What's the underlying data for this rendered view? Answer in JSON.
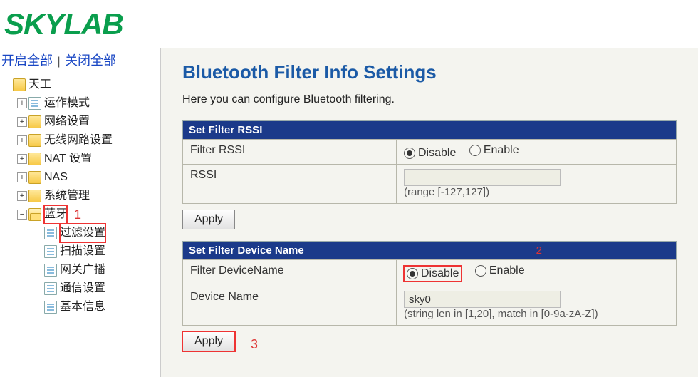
{
  "logo": "SKYLAB",
  "top_links": {
    "open_all": "开启全部",
    "close_all": "关闭全部"
  },
  "tree": {
    "root": "天工",
    "items": [
      "运作模式",
      "网络设置",
      "无线网路设置",
      "NAT 设置",
      "NAS",
      "系统管理"
    ],
    "bluetooth": "蓝牙",
    "bt_children": [
      "过滤设置",
      "扫描设置",
      "网关广播",
      "通信设置",
      "基本信息"
    ]
  },
  "page": {
    "title": "Bluetooth Filter Info Settings",
    "subtitle": "Here you can configure Bluetooth filtering."
  },
  "rssi": {
    "header": "Set Filter RSSI",
    "row1_label": "Filter RSSI",
    "row2_label": "RSSI",
    "disable": "Disable",
    "enable": "Enable",
    "value": "",
    "hint": "(range [-127,127])",
    "apply": "Apply"
  },
  "devname": {
    "header": "Set Filter Device Name",
    "row1_label": "Filter DeviceName",
    "row2_label": "Device Name",
    "disable": "Disable",
    "enable": "Enable",
    "value": "sky0",
    "hint": "(string len in [1,20], match in [0-9a-zA-Z])",
    "apply": "Apply"
  },
  "annotations": {
    "a1": "1",
    "a2": "2",
    "a3": "3"
  }
}
